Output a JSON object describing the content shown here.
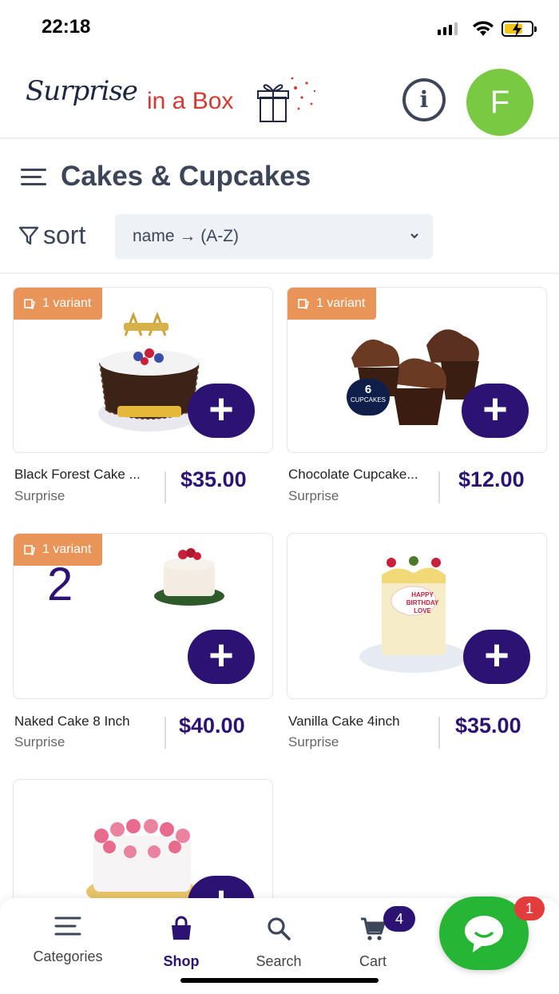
{
  "status_bar": {
    "time": "22:18"
  },
  "header": {
    "logo_script": "Surprise",
    "logo_text": "in a Box",
    "avatar_initial": "F"
  },
  "page": {
    "title": "Cakes & Cupcakes",
    "sort_label": "sort",
    "sort_value": "name → (A-Z)"
  },
  "colors": {
    "accent": "#2b1273",
    "badge": "#e9955a",
    "avatar": "#7ac943",
    "chat": "#27b535",
    "notification": "#e23c3c"
  },
  "products": [
    {
      "badge": "1 variant",
      "name": "Black Forest Cake ...",
      "vendor": "Surprise",
      "price": "$35.00"
    },
    {
      "badge": "1 variant",
      "name": "Chocolate Cupcake...",
      "vendor": "Surprise",
      "price": "$12.00",
      "overlay_top": "6",
      "overlay_bottom": "CUPCAKES"
    },
    {
      "badge": "1 variant",
      "name": "Naked Cake 8 Inch",
      "vendor": "Surprise",
      "price": "$40.00",
      "overlay": "2"
    },
    {
      "name": "Vanilla Cake 4inch",
      "vendor": "Surprise",
      "price": "$35.00",
      "cake_text": "HAPPY BIRTHDAY LOVE"
    },
    {}
  ],
  "bottom_nav": [
    {
      "label": "Categories",
      "icon": "menu-icon"
    },
    {
      "label": "Shop",
      "icon": "shopping-bag-icon",
      "active": true
    },
    {
      "label": "Search",
      "icon": "search-icon"
    },
    {
      "label": "Cart",
      "icon": "cart-icon",
      "badge": "4"
    }
  ],
  "chat": {
    "badge": "1"
  }
}
